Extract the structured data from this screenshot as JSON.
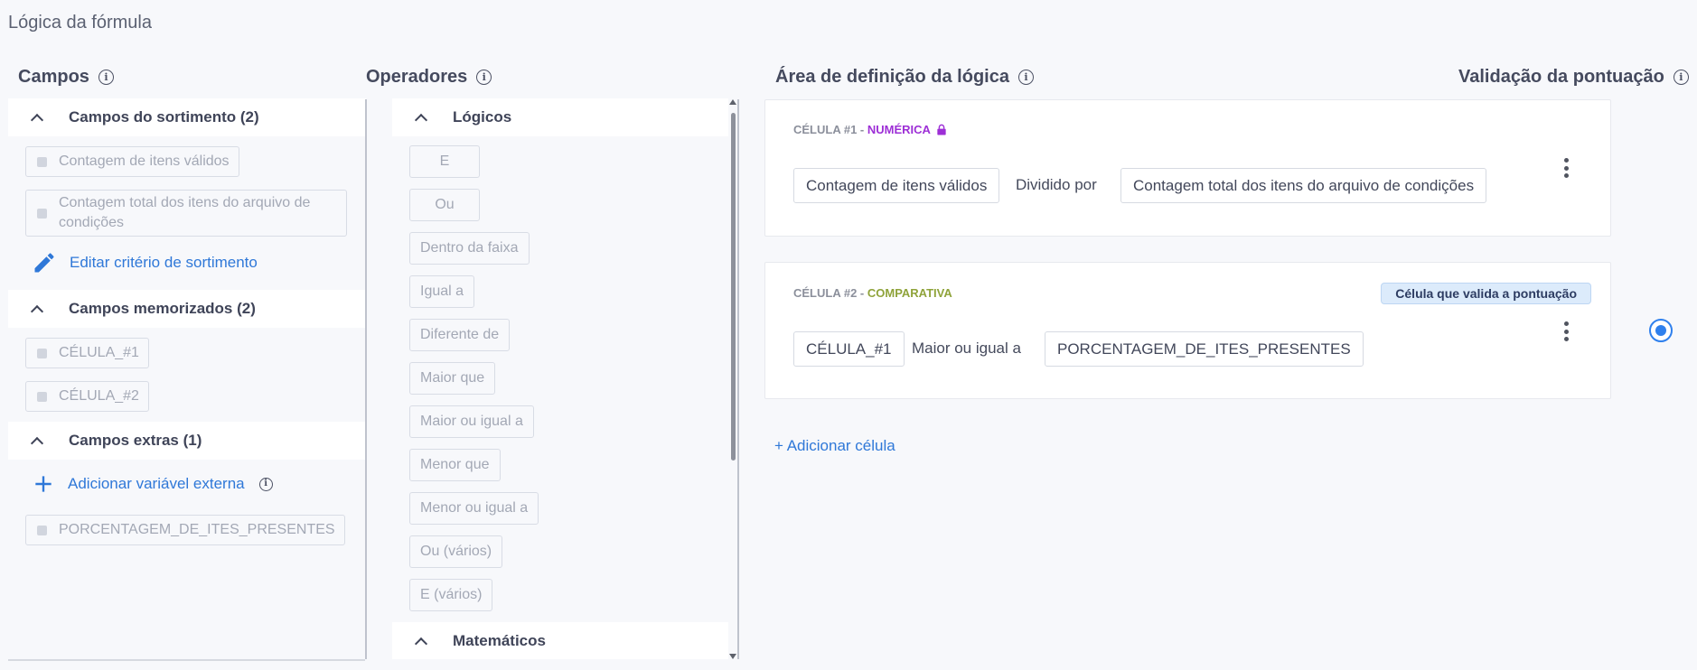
{
  "page_title": "Lógica da fórmula",
  "columns": {
    "campos": "Campos",
    "operadores": "Operadores",
    "area": "Área de definição da lógica",
    "validacao": "Validação da pontuação"
  },
  "campos": {
    "groups": [
      {
        "title": "Campos do sortimento (2)",
        "items": [
          "Contagem de itens válidos",
          "Contagem total dos itens do arquivo de condições"
        ],
        "action": "Editar critério de sortimento"
      },
      {
        "title": "Campos memorizados (2)",
        "items": [
          "CÉLULA_#1",
          "CÉLULA_#2"
        ]
      },
      {
        "title": "Campos extras (1)",
        "action": "Adicionar variável externa",
        "items": [
          "PORCENTAGEM_DE_ITES_PRESENTES"
        ]
      }
    ]
  },
  "operadores": {
    "groups": [
      {
        "title": "Lógicos",
        "items": [
          "E",
          "Ou",
          "Dentro da faixa",
          "Igual a",
          "Diferente de",
          "Maior que",
          "Maior ou igual a",
          "Menor que",
          "Menor ou igual a",
          "Ou (vários)",
          "E (vários)"
        ]
      },
      {
        "title": "Matemáticos"
      }
    ]
  },
  "cells": [
    {
      "label": "CÉLULA #1",
      "sep": " - ",
      "type": "NUMÉRICA",
      "locked": true,
      "left": "Contagem de itens válidos",
      "operator": "Dividido por",
      "right": "Contagem total dos itens do arquivo de condições"
    },
    {
      "label": "CÉLULA #2",
      "sep": " - ",
      "type": "COMPARATIVA",
      "badge": "Célula que valida a pontuação",
      "left": "CÉLULA_#1",
      "operator": "Maior ou igual a",
      "right": "PORCENTAGEM_DE_ITES_PRESENTES"
    }
  ],
  "add_cell": "+ Adicionar célula",
  "icons": {
    "info": "info-icon",
    "collapse": "chevron-up-icon",
    "edit": "pencil-icon",
    "add": "plus-icon",
    "lock": "lock-icon",
    "menu": "kebab-icon"
  },
  "colors": {
    "accent": "#2f78d8",
    "numeric": "#9d2fd6",
    "comparative": "#8fa33a",
    "badge_bg": "#dcebfb"
  }
}
